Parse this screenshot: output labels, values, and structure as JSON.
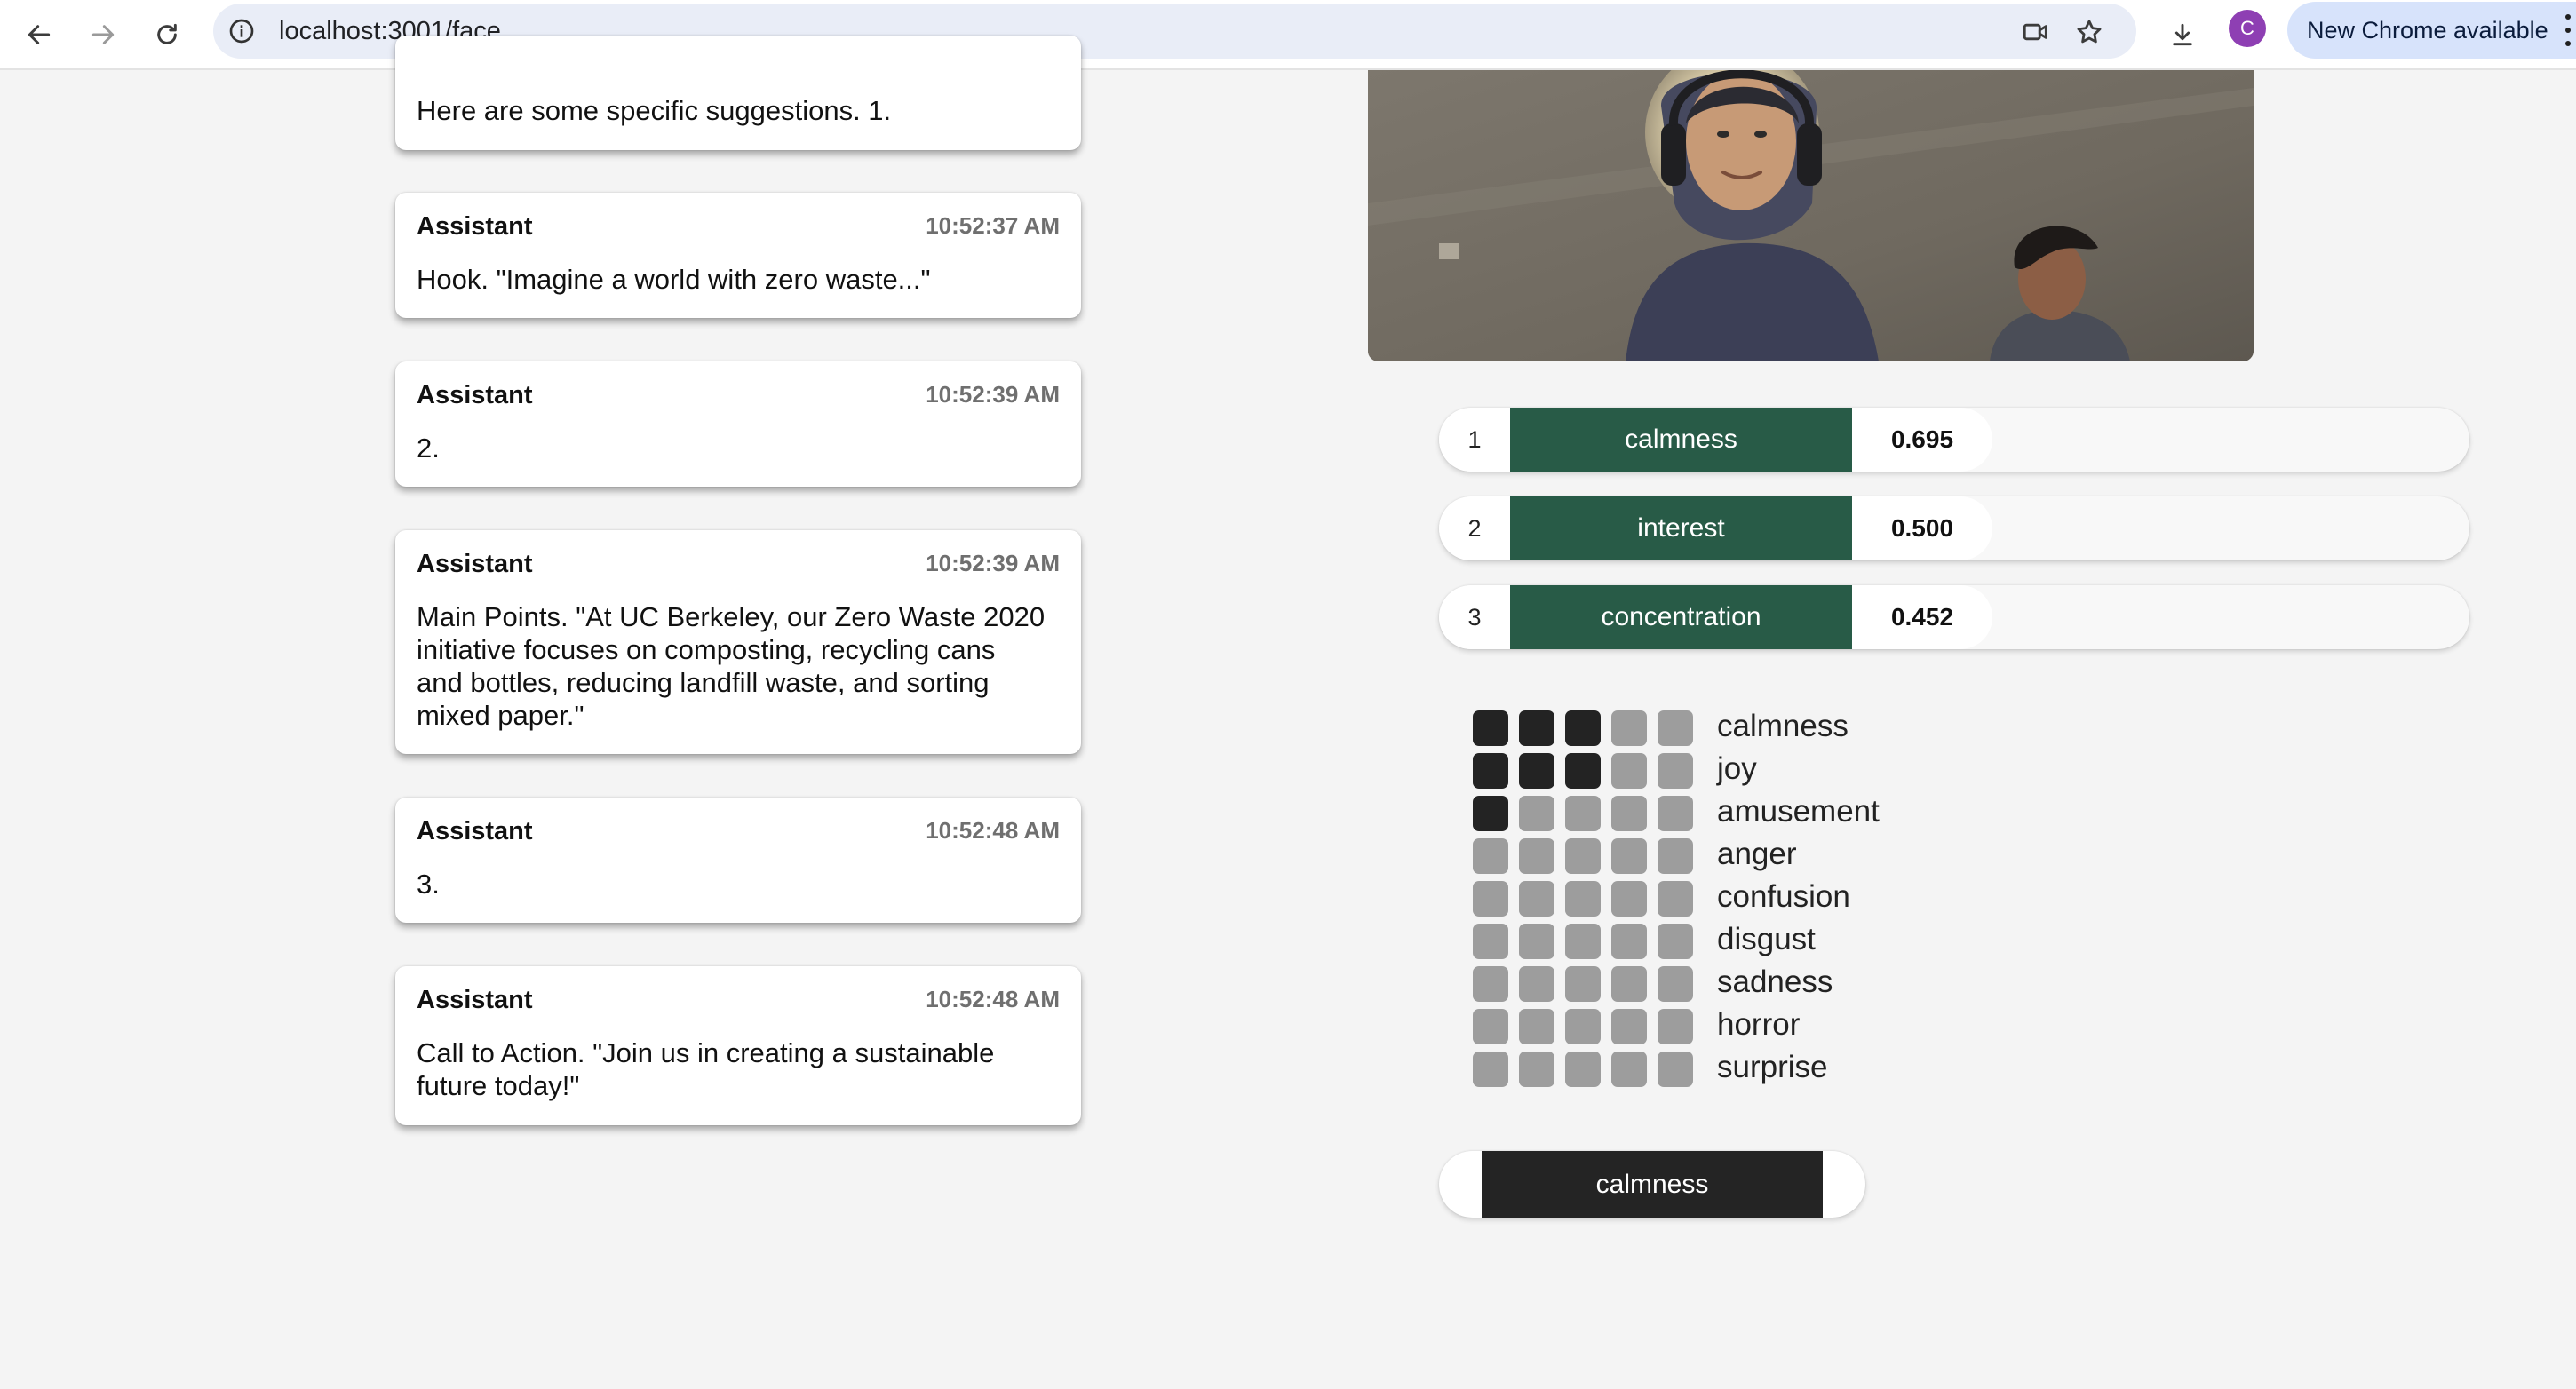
{
  "browser": {
    "url": "localhost:3001/face",
    "avatar_initial": "C",
    "update_label": "New Chrome available"
  },
  "chat": [
    {
      "role": "",
      "time": "",
      "text": "Here are some specific suggestions. 1."
    },
    {
      "role": "Assistant",
      "time": "10:52:37 AM",
      "text": "Hook. \"Imagine a world with zero waste...\""
    },
    {
      "role": "Assistant",
      "time": "10:52:39 AM",
      "text": "2."
    },
    {
      "role": "Assistant",
      "time": "10:52:39 AM",
      "text": "Main Points. \"At UC Berkeley, our Zero Waste 2020 initiative focuses on composting, recycling cans and bottles, reducing landfill waste, and sorting mixed paper.\""
    },
    {
      "role": "Assistant",
      "time": "10:52:48 AM",
      "text": "3."
    },
    {
      "role": "Assistant",
      "time": "10:52:48 AM",
      "text": "Call to Action. \"Join us in creating a sustainable future today!\""
    }
  ],
  "top_emotions": [
    {
      "rank": "1",
      "label": "calmness",
      "score": "0.695"
    },
    {
      "rank": "2",
      "label": "interest",
      "score": "0.500"
    },
    {
      "rank": "3",
      "label": "concentration",
      "score": "0.452"
    }
  ],
  "emotion_levels": [
    {
      "name": "calmness",
      "level": 3,
      "max": 5
    },
    {
      "name": "joy",
      "level": 3,
      "max": 5
    },
    {
      "name": "amusement",
      "level": 1,
      "max": 5
    },
    {
      "name": "anger",
      "level": 0,
      "max": 5
    },
    {
      "name": "confusion",
      "level": 0,
      "max": 5
    },
    {
      "name": "disgust",
      "level": 0,
      "max": 5
    },
    {
      "name": "sadness",
      "level": 0,
      "max": 5
    },
    {
      "name": "horror",
      "level": 0,
      "max": 5
    },
    {
      "name": "surprise",
      "level": 0,
      "max": 5
    }
  ],
  "selected_emotion": "calmness",
  "colors": {
    "accent_green": "#285b47",
    "level_on": "#232323",
    "level_off": "#9d9d9d"
  }
}
